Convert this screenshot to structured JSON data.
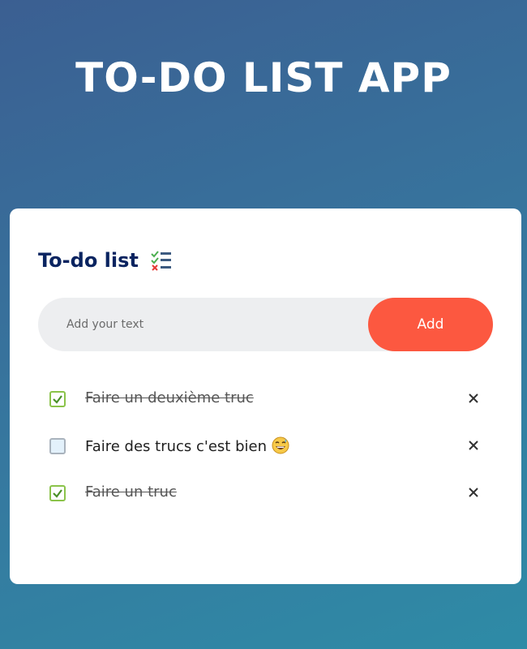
{
  "app": {
    "title": "TO-DO LIST APP"
  },
  "card": {
    "title": "To-do list",
    "title_icon": "checklist-icon",
    "input_placeholder": "Add your text",
    "input_value": "",
    "add_label": "Add"
  },
  "todos": [
    {
      "text": "Faire un deuxième truc",
      "done": true,
      "emoji": null
    },
    {
      "text": "Faire des trucs c'est bien",
      "done": false,
      "emoji": "grinning-sweat-face-icon"
    },
    {
      "text": "Faire un truc",
      "done": true,
      "emoji": null
    }
  ],
  "colors": {
    "accent": "#fc5840",
    "title": "#0a2460",
    "check": "#8bc34a",
    "background_start": "#3b5f92",
    "background_end": "#2e8ba6"
  }
}
